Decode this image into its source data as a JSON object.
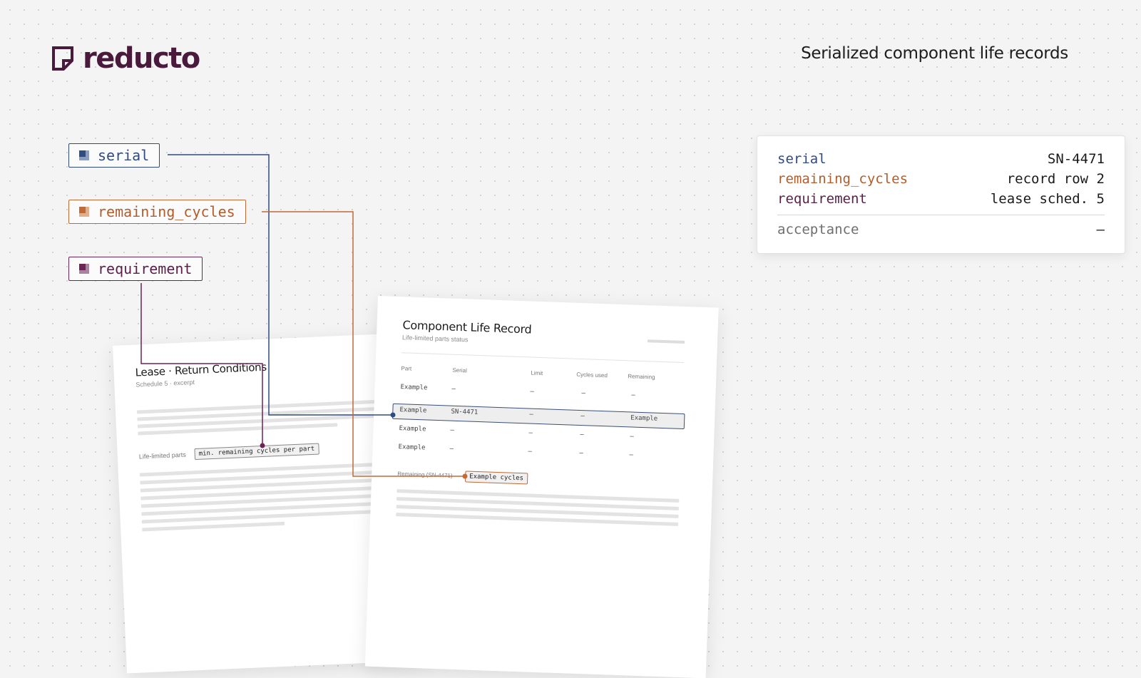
{
  "brand": {
    "name": "reducto",
    "color": "#4a1a3c"
  },
  "header": {
    "title": "Serialized component life records"
  },
  "fields": [
    {
      "label": "serial",
      "color": "#2f4b82"
    },
    {
      "label": "remaining_cycles",
      "color": "#c06a38"
    },
    {
      "label": "requirement",
      "color": "#6c2456"
    }
  ],
  "result": {
    "rows": [
      {
        "key": "serial",
        "value": "SN-4471"
      },
      {
        "key": "remaining_cycles",
        "value": "record row 2"
      },
      {
        "key": "requirement",
        "value": "lease sched. 5"
      }
    ],
    "footer": {
      "key": "acceptance",
      "value": "—"
    }
  },
  "lease_doc": {
    "title": "Lease · Return Conditions",
    "subtitle": "Schedule 5 · excerpt",
    "field_label": "Life-limited parts",
    "chip": "min. remaining cycles per part"
  },
  "record_doc": {
    "title": "Component Life Record",
    "subtitle": "Life-limited parts status",
    "columns": [
      "Part",
      "Serial",
      "Limit",
      "Cycles used",
      "Remaining"
    ],
    "rows": [
      [
        "Example",
        "–",
        "–",
        "–",
        "–"
      ],
      [
        "Example",
        "SN-4471",
        "–",
        "–",
        "Example"
      ],
      [
        "Example",
        "–",
        "–",
        "–",
        "–"
      ],
      [
        "Example",
        "–",
        "–",
        "–",
        "–"
      ]
    ],
    "highlight_row": 1,
    "remaining_label": "Remaining (SN-4471)",
    "remaining_chip": "Example cycles"
  }
}
